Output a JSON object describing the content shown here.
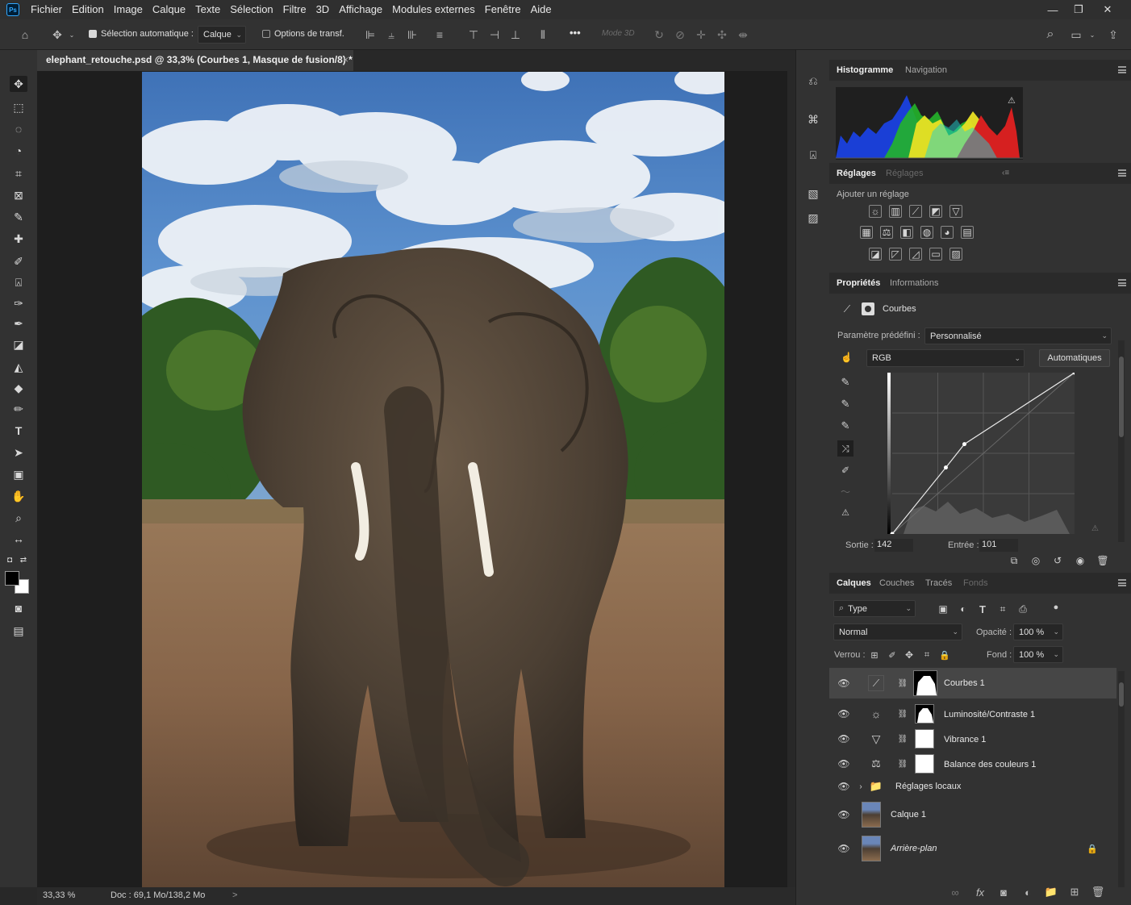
{
  "app": {
    "logo": "Ps",
    "menu": [
      "Fichier",
      "Edition",
      "Image",
      "Calque",
      "Texte",
      "Sélection",
      "Filtre",
      "3D",
      "Affichage",
      "Modules externes",
      "Fenêtre",
      "Aide"
    ],
    "window_controls": [
      "—",
      "❐",
      "✕"
    ]
  },
  "options_bar": {
    "auto_select_label": "Sélection automatique :",
    "auto_select_checked": true,
    "auto_select_target": "Calque",
    "transform_label": "Options de transf.",
    "transform_checked": false,
    "more_label": "•••",
    "mode_3d_label": "Mode 3D"
  },
  "document": {
    "tab_title": "elephant_retouche.psd @ 33,3% (Courbes 1, Masque de fusion/8) *",
    "close": "×",
    "zoom": "33,33 %",
    "doc_info": "Doc : 69,1 Mo/138,2 Mo",
    "status_arrow": ">"
  },
  "histogram_panel": {
    "tabs": [
      "Histogramme",
      "Navigation"
    ]
  },
  "adjustments_panel": {
    "tabs": [
      "Réglages",
      "Réglages"
    ],
    "add_label": "Ajouter un réglage",
    "row1": [
      "luminosity-contrast-icon",
      "levels-icon",
      "curves-icon",
      "exposure-icon",
      "vibrance-icon"
    ],
    "row2": [
      "hue-saturation-icon",
      "color-balance-icon",
      "black-white-icon",
      "photo-filter-icon",
      "channel-mixer-icon",
      "color-lookup-icon"
    ],
    "row3": [
      "invert-icon",
      "posterize-icon",
      "threshold-icon",
      "gradient-map-icon",
      "selective-color-icon"
    ]
  },
  "properties_panel": {
    "tabs": [
      "Propriétés",
      "Informations"
    ],
    "type_label": "Courbes",
    "preset_label": "Paramètre prédéfini :",
    "preset_value": "Personnalisé",
    "channel_value": "RGB",
    "auto_button": "Automatiques",
    "output_label": "Sortie :",
    "output_value": "142",
    "input_label": "Entrée :",
    "input_value": "101",
    "curve_points": [
      {
        "in": 0,
        "out": 0
      },
      {
        "in": 75,
        "out": 105
      },
      {
        "in": 101,
        "out": 142
      },
      {
        "in": 255,
        "out": 255
      }
    ]
  },
  "layers_panel": {
    "tabs": [
      "Calques",
      "Couches",
      "Tracés",
      "Fonds"
    ],
    "filter_label": "Type",
    "blend_mode": "Normal",
    "opacity_label": "Opacité :",
    "opacity_value": "100 %",
    "lock_label": "Verrou :",
    "fill_label": "Fond :",
    "fill_value": "100 %",
    "layers": [
      {
        "name": "Courbes 1",
        "type": "curves",
        "selected": true
      },
      {
        "name": "Luminosité/Contraste 1",
        "type": "brightness",
        "selected": false
      },
      {
        "name": "Vibrance 1",
        "type": "vibrance",
        "selected": false
      },
      {
        "name": "Balance des couleurs 1",
        "type": "color-balance",
        "selected": false
      },
      {
        "name": "Réglages locaux",
        "type": "group",
        "selected": false
      },
      {
        "name": "Calque 1",
        "type": "pixel",
        "selected": false
      },
      {
        "name": "Arrière-plan",
        "type": "background",
        "selected": false
      }
    ]
  },
  "colors": {
    "foreground": "#000000",
    "background": "#ffffff"
  }
}
